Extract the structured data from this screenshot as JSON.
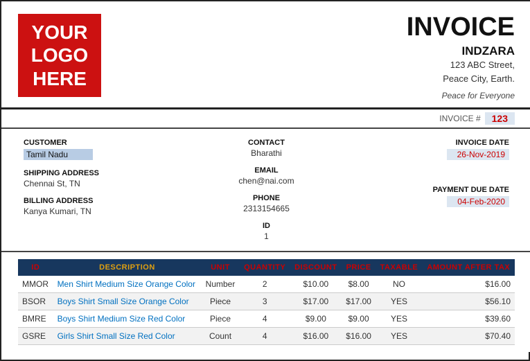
{
  "header": {
    "logo_line1": "YOUR",
    "logo_line2": "LOGO",
    "logo_line3": "HERE",
    "invoice_title": "INVOICE",
    "company_name": "INDZARA",
    "company_address_line1": "123 ABC Street,",
    "company_address_line2": "Peace City, Earth.",
    "tagline": "Peace for Everyone"
  },
  "invoice_bar": {
    "label": "INVOICE #",
    "value": "123"
  },
  "customer": {
    "customer_label": "CUSTOMER",
    "customer_value": "Tamil Nadu",
    "contact_label": "CONTACT",
    "contact_value": "Bharathi",
    "invoice_date_label": "INVOICE DATE",
    "invoice_date_value": "26-Nov-2019",
    "shipping_label": "SHIPPING ADDRESS",
    "shipping_value": "Chennai St, TN",
    "email_label": "EMAIL",
    "email_value": "chen@nai.com",
    "payment_due_label": "PAYMENT DUE DATE",
    "payment_due_value": "04-Feb-2020",
    "billing_label": "BILLING ADDRESS",
    "billing_value": "Kanya Kumari, TN",
    "phone_label": "PHONE",
    "phone_value": "2313154665",
    "id_label": "ID",
    "id_value": "1"
  },
  "table": {
    "columns": [
      "ID",
      "DESCRIPTION",
      "UNIT",
      "QUANTITY",
      "DISCOUNT",
      "PRICE",
      "TAXABLE",
      "AMOUNT AFTER TAX"
    ],
    "rows": [
      {
        "id": "MMOR",
        "description": "Men Shirt Medium Size Orange Color",
        "unit": "Number",
        "quantity": "2",
        "discount": "$10.00",
        "price": "$8.00",
        "taxable": "NO",
        "amount": "$16.00"
      },
      {
        "id": "BSOR",
        "description": "Boys Shirt Small Size Orange Color",
        "unit": "Piece",
        "quantity": "3",
        "discount": "$17.00",
        "price": "$17.00",
        "taxable": "YES",
        "amount": "$56.10"
      },
      {
        "id": "BMRE",
        "description": "Boys Shirt Medium Size Red Color",
        "unit": "Piece",
        "quantity": "4",
        "discount": "$9.00",
        "price": "$9.00",
        "taxable": "YES",
        "amount": "$39.60"
      },
      {
        "id": "GSRE",
        "description": "Girls Shirt Small Size Red Color",
        "unit": "Count",
        "quantity": "4",
        "discount": "$16.00",
        "price": "$16.00",
        "taxable": "YES",
        "amount": "$70.40"
      }
    ]
  }
}
